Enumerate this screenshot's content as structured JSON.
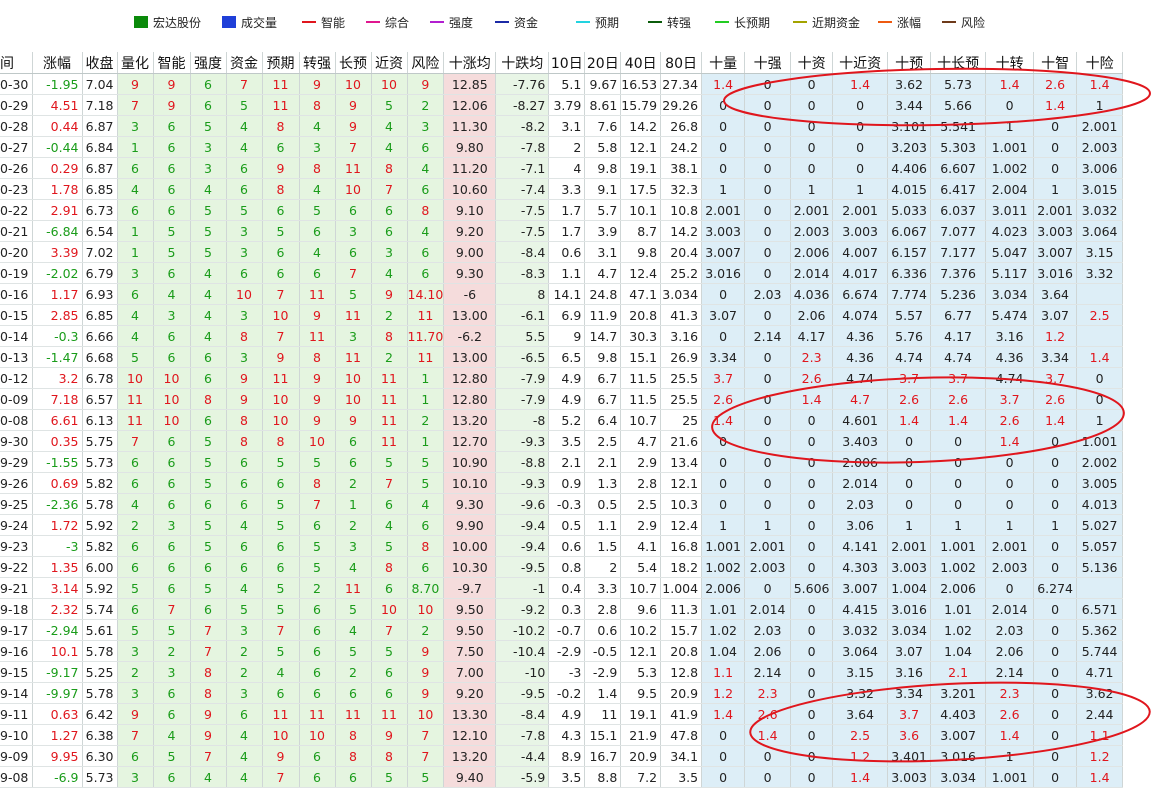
{
  "legend": [
    {
      "label": "宏达股份",
      "kind": "box",
      "color": "#0a8a0a"
    },
    {
      "label": "成交量",
      "kind": "box",
      "color": "#1f3fd8"
    },
    {
      "label": "智能",
      "kind": "line",
      "color": "#e0161d"
    },
    {
      "label": "综合",
      "kind": "line",
      "color": "#e0168f"
    },
    {
      "label": "强度",
      "kind": "line",
      "color": "#b21fd0"
    },
    {
      "label": "资金",
      "kind": "line",
      "color": "#1b2aa6"
    },
    {
      "label": "预期",
      "kind": "line",
      "color": "#22d3e0"
    },
    {
      "label": "转强",
      "kind": "line",
      "color": "#0b5c0b"
    },
    {
      "label": "长预期",
      "kind": "line",
      "color": "#22cc22"
    },
    {
      "label": "近期资金",
      "kind": "line",
      "color": "#a3a300"
    },
    {
      "label": "涨幅",
      "kind": "line",
      "color": "#ee5a10"
    },
    {
      "label": "风险",
      "kind": "line",
      "color": "#6e3a1a"
    }
  ],
  "headers": [
    "间",
    "涨幅",
    "收盘",
    "量化",
    "智能",
    "强度",
    "资金",
    "预期",
    "转强",
    "长预",
    "近资",
    "风险",
    "十涨均",
    "十跌均",
    "10日",
    "20日",
    "40日",
    "80日",
    "十量",
    "十强",
    "十资",
    "十近资",
    "十预",
    "十长预",
    "十转",
    "十智",
    "十险"
  ],
  "rows": [
    [
      "0-30",
      "-1.95",
      "7.04",
      "9",
      "9",
      "6",
      "7",
      "11",
      "9",
      "10",
      "10",
      "9",
      "12.85",
      "-7.76",
      "5.1",
      "9.67",
      "16.53",
      "27.34",
      "1.4",
      "0",
      "0",
      "1.4",
      "3.62",
      "5.73",
      "1.4",
      "2.6",
      "1.4"
    ],
    [
      "0-29",
      "4.51",
      "7.18",
      "7",
      "9",
      "6",
      "5",
      "11",
      "8",
      "9",
      "5",
      "2",
      "12.06",
      "-8.27",
      "3.79",
      "8.61",
      "15.79",
      "29.26",
      "0",
      "0",
      "0",
      "0",
      "3.44",
      "5.66",
      "0",
      "1.4",
      "1"
    ],
    [
      "0-28",
      "0.44",
      "6.87",
      "3",
      "6",
      "5",
      "4",
      "8",
      "4",
      "9",
      "4",
      "3",
      "11.30",
      "-8.2",
      "3.1",
      "7.6",
      "14.2",
      "26.8",
      "0",
      "0",
      "0",
      "0",
      "3.101",
      "5.541",
      "1",
      "0",
      "2.001"
    ],
    [
      "0-27",
      "-0.44",
      "6.84",
      "1",
      "6",
      "3",
      "4",
      "6",
      "3",
      "7",
      "4",
      "6",
      "9.80",
      "-7.8",
      "2",
      "5.8",
      "12.1",
      "24.2",
      "0",
      "0",
      "0",
      "0",
      "3.203",
      "5.303",
      "1.001",
      "0",
      "2.003"
    ],
    [
      "0-26",
      "0.29",
      "6.87",
      "6",
      "6",
      "3",
      "6",
      "9",
      "8",
      "11",
      "8",
      "4",
      "11.20",
      "-7.1",
      "4",
      "9.8",
      "19.1",
      "38.1",
      "0",
      "0",
      "0",
      "0",
      "4.406",
      "6.607",
      "1.002",
      "0",
      "3.006"
    ],
    [
      "0-23",
      "1.78",
      "6.85",
      "4",
      "6",
      "4",
      "6",
      "8",
      "4",
      "10",
      "7",
      "6",
      "10.60",
      "-7.4",
      "3.3",
      "9.1",
      "17.5",
      "32.3",
      "1",
      "0",
      "1",
      "1",
      "4.015",
      "6.417",
      "2.004",
      "1",
      "3.015"
    ],
    [
      "0-22",
      "2.91",
      "6.73",
      "6",
      "6",
      "5",
      "5",
      "6",
      "5",
      "6",
      "6",
      "8",
      "9.10",
      "-7.5",
      "1.7",
      "5.7",
      "10.1",
      "10.8",
      "2.001",
      "0",
      "2.001",
      "2.001",
      "5.033",
      "6.037",
      "3.011",
      "2.001",
      "3.032"
    ],
    [
      "0-21",
      "-6.84",
      "6.54",
      "1",
      "5",
      "5",
      "3",
      "5",
      "6",
      "3",
      "6",
      "4",
      "9.20",
      "-7.5",
      "1.7",
      "3.9",
      "8.7",
      "14.2",
      "3.003",
      "0",
      "2.003",
      "3.003",
      "6.067",
      "7.077",
      "4.023",
      "3.003",
      "3.064"
    ],
    [
      "0-20",
      "3.39",
      "7.02",
      "1",
      "5",
      "5",
      "3",
      "6",
      "4",
      "6",
      "3",
      "6",
      "9.00",
      "-8.4",
      "0.6",
      "3.1",
      "9.8",
      "20.4",
      "3.007",
      "0",
      "2.006",
      "4.007",
      "6.157",
      "7.177",
      "5.047",
      "3.007",
      "3.15"
    ],
    [
      "0-19",
      "-2.02",
      "6.79",
      "3",
      "6",
      "4",
      "6",
      "6",
      "6",
      "7",
      "4",
      "6",
      "9.30",
      "-8.3",
      "1.1",
      "4.7",
      "12.4",
      "25.2",
      "3.016",
      "0",
      "2.014",
      "4.017",
      "6.336",
      "7.376",
      "5.117",
      "3.016",
      "3.32"
    ],
    [
      "0-16",
      "1.17",
      "6.93",
      "6",
      "4",
      "4",
      "10",
      "7",
      "11",
      "5",
      "9",
      "14.10",
      "-6",
      "8",
      "14.1",
      "24.8",
      "47.1",
      "3.034",
      "0",
      "2.03",
      "4.036",
      "6.674",
      "7.774",
      "5.236",
      "3.034",
      "3.64",
      ""
    ],
    [
      "0-15",
      "2.85",
      "6.85",
      "4",
      "3",
      "4",
      "3",
      "10",
      "9",
      "11",
      "2",
      "11",
      "13.00",
      "-6.1",
      "6.9",
      "11.9",
      "20.8",
      "41.3",
      "3.07",
      "0",
      "2.06",
      "4.074",
      "5.57",
      "6.77",
      "5.474",
      "3.07",
      "2.5"
    ],
    [
      "0-14",
      "-0.3",
      "6.66",
      "4",
      "6",
      "4",
      "8",
      "7",
      "11",
      "3",
      "8",
      "11.70",
      "-6.2",
      "5.5",
      "9",
      "14.7",
      "30.3",
      "3.16",
      "0",
      "2.14",
      "4.17",
      "4.36",
      "5.76",
      "4.17",
      "3.16",
      "1.2",
      ""
    ],
    [
      "0-13",
      "-1.47",
      "6.68",
      "5",
      "6",
      "6",
      "3",
      "9",
      "8",
      "11",
      "2",
      "11",
      "13.00",
      "-6.5",
      "6.5",
      "9.8",
      "15.1",
      "26.9",
      "3.34",
      "0",
      "2.3",
      "4.36",
      "4.74",
      "4.74",
      "4.36",
      "3.34",
      "1.4"
    ],
    [
      "0-12",
      "3.2",
      "6.78",
      "10",
      "10",
      "6",
      "9",
      "11",
      "9",
      "10",
      "11",
      "1",
      "12.80",
      "-7.9",
      "4.9",
      "6.7",
      "11.5",
      "25.5",
      "3.7",
      "0",
      "2.6",
      "4.74",
      "3.7",
      "3.7",
      "4.74",
      "3.7",
      "0"
    ],
    [
      "0-09",
      "7.18",
      "6.57",
      "11",
      "10",
      "8",
      "9",
      "10",
      "9",
      "10",
      "11",
      "1",
      "12.80",
      "-7.9",
      "4.9",
      "6.7",
      "11.5",
      "25.5",
      "2.6",
      "0",
      "1.4",
      "4.7",
      "2.6",
      "2.6",
      "3.7",
      "2.6",
      "0"
    ],
    [
      "0-08",
      "6.61",
      "6.13",
      "11",
      "10",
      "6",
      "8",
      "10",
      "9",
      "9",
      "11",
      "2",
      "13.20",
      "-8",
      "5.2",
      "6.4",
      "10.7",
      "25",
      "1.4",
      "0",
      "0",
      "4.601",
      "1.4",
      "1.4",
      "2.6",
      "1.4",
      "1"
    ],
    [
      "9-30",
      "0.35",
      "5.75",
      "7",
      "6",
      "5",
      "8",
      "8",
      "10",
      "6",
      "11",
      "1",
      "12.70",
      "-9.3",
      "3.5",
      "2.5",
      "4.7",
      "21.6",
      "0",
      "0",
      "0",
      "3.403",
      "0",
      "0",
      "1.4",
      "0",
      "1.001"
    ],
    [
      "9-29",
      "-1.55",
      "5.73",
      "6",
      "6",
      "5",
      "6",
      "5",
      "5",
      "6",
      "5",
      "5",
      "10.90",
      "-8.8",
      "2.1",
      "2.1",
      "2.9",
      "13.4",
      "0",
      "0",
      "0",
      "2.006",
      "0",
      "0",
      "0",
      "0",
      "2.002"
    ],
    [
      "9-26",
      "0.69",
      "5.82",
      "6",
      "6",
      "5",
      "6",
      "6",
      "8",
      "2",
      "7",
      "5",
      "10.10",
      "-9.3",
      "0.9",
      "1.3",
      "2.8",
      "12.1",
      "0",
      "0",
      "0",
      "2.014",
      "0",
      "0",
      "0",
      "0",
      "3.005"
    ],
    [
      "9-25",
      "-2.36",
      "5.78",
      "4",
      "6",
      "6",
      "6",
      "5",
      "7",
      "1",
      "6",
      "4",
      "9.30",
      "-9.6",
      "-0.3",
      "0.5",
      "2.5",
      "10.3",
      "0",
      "0",
      "0",
      "2.03",
      "0",
      "0",
      "0",
      "0",
      "4.013"
    ],
    [
      "9-24",
      "1.72",
      "5.92",
      "2",
      "3",
      "5",
      "4",
      "5",
      "6",
      "2",
      "4",
      "6",
      "9.90",
      "-9.4",
      "0.5",
      "1.1",
      "2.9",
      "12.4",
      "1",
      "1",
      "0",
      "3.06",
      "1",
      "1",
      "1",
      "1",
      "5.027"
    ],
    [
      "9-23",
      "-3",
      "5.82",
      "6",
      "6",
      "5",
      "6",
      "6",
      "5",
      "3",
      "5",
      "8",
      "10.00",
      "-9.4",
      "0.6",
      "1.5",
      "4.1",
      "16.8",
      "1.001",
      "2.001",
      "0",
      "4.141",
      "2.001",
      "1.001",
      "2.001",
      "0",
      "5.057"
    ],
    [
      "9-22",
      "1.35",
      "6.00",
      "6",
      "6",
      "6",
      "6",
      "6",
      "5",
      "4",
      "8",
      "6",
      "10.30",
      "-9.5",
      "0.8",
      "2",
      "5.4",
      "18.2",
      "1.002",
      "2.003",
      "0",
      "4.303",
      "3.003",
      "1.002",
      "2.003",
      "0",
      "5.136"
    ],
    [
      "9-21",
      "3.14",
      "5.92",
      "5",
      "6",
      "5",
      "4",
      "5",
      "2",
      "11",
      "6",
      "8.70",
      "-9.7",
      "-1",
      "0.4",
      "3.3",
      "10.7",
      "1.004",
      "2.006",
      "0",
      "5.606",
      "3.007",
      "1.004",
      "2.006",
      "0",
      "6.274",
      ""
    ],
    [
      "9-18",
      "2.32",
      "5.74",
      "6",
      "7",
      "6",
      "5",
      "5",
      "6",
      "5",
      "10",
      "10",
      "9.50",
      "-9.2",
      "0.3",
      "2.8",
      "9.6",
      "11.3",
      "1.01",
      "2.014",
      "0",
      "4.415",
      "3.016",
      "1.01",
      "2.014",
      "0",
      "6.571"
    ],
    [
      "9-17",
      "-2.94",
      "5.61",
      "5",
      "5",
      "7",
      "3",
      "7",
      "6",
      "4",
      "7",
      "2",
      "9.50",
      "-10.2",
      "-0.7",
      "0.6",
      "10.2",
      "15.7",
      "1.02",
      "2.03",
      "0",
      "3.032",
      "3.034",
      "1.02",
      "2.03",
      "0",
      "5.362"
    ],
    [
      "9-16",
      "10.1",
      "5.78",
      "3",
      "2",
      "7",
      "2",
      "5",
      "6",
      "5",
      "5",
      "9",
      "7.50",
      "-10.4",
      "-2.9",
      "-0.5",
      "12.1",
      "20.8",
      "1.04",
      "2.06",
      "0",
      "3.064",
      "3.07",
      "1.04",
      "2.06",
      "0",
      "5.744"
    ],
    [
      "9-15",
      "-9.17",
      "5.25",
      "2",
      "3",
      "8",
      "2",
      "4",
      "6",
      "2",
      "6",
      "9",
      "7.00",
      "-10",
      "-3",
      "-2.9",
      "5.3",
      "12.8",
      "1.1",
      "2.14",
      "0",
      "3.15",
      "3.16",
      "2.1",
      "2.14",
      "0",
      "4.71"
    ],
    [
      "9-14",
      "-9.97",
      "5.78",
      "3",
      "6",
      "8",
      "3",
      "6",
      "6",
      "6",
      "6",
      "9",
      "9.20",
      "-9.5",
      "-0.2",
      "1.4",
      "9.5",
      "20.9",
      "1.2",
      "2.3",
      "0",
      "3.32",
      "3.34",
      "3.201",
      "2.3",
      "0",
      "3.62"
    ],
    [
      "9-11",
      "0.63",
      "6.42",
      "9",
      "6",
      "9",
      "6",
      "11",
      "11",
      "11",
      "11",
      "10",
      "13.30",
      "-8.4",
      "4.9",
      "11",
      "19.1",
      "41.9",
      "1.4",
      "2.6",
      "0",
      "3.64",
      "3.7",
      "4.403",
      "2.6",
      "0",
      "2.44"
    ],
    [
      "9-10",
      "1.27",
      "6.38",
      "7",
      "4",
      "9",
      "4",
      "10",
      "10",
      "8",
      "9",
      "7",
      "12.10",
      "-7.8",
      "4.3",
      "15.1",
      "21.9",
      "47.8",
      "0",
      "1.4",
      "0",
      "2.5",
      "3.6",
      "3.007",
      "1.4",
      "0",
      "1.1"
    ],
    [
      "9-09",
      "9.95",
      "6.30",
      "6",
      "5",
      "7",
      "4",
      "9",
      "6",
      "8",
      "8",
      "7",
      "13.20",
      "-4.4",
      "8.9",
      "16.7",
      "20.9",
      "34.1",
      "0",
      "0",
      "0",
      "1.2",
      "3.401",
      "3.016",
      "1",
      "0",
      "1.2"
    ],
    [
      "9-08",
      "-6.9",
      "5.73",
      "3",
      "6",
      "4",
      "4",
      "7",
      "6",
      "6",
      "5",
      "5",
      "9.40",
      "-5.9",
      "3.5",
      "8.8",
      "7.2",
      "3.5",
      "0",
      "0",
      "0",
      "1.4",
      "3.003",
      "3.034",
      "1.001",
      "0",
      "1.4"
    ]
  ]
}
